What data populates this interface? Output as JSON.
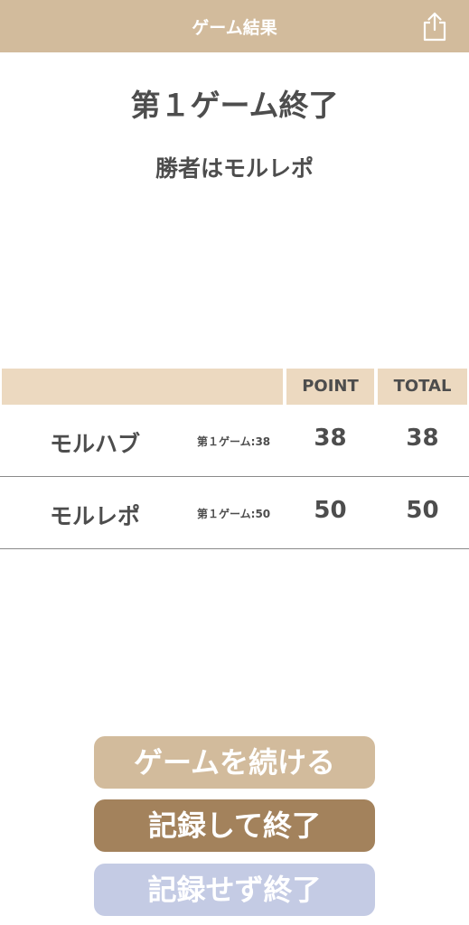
{
  "header": {
    "title": "ゲーム結果",
    "share_icon": "share-icon"
  },
  "main": {
    "game_title": "第１ゲーム終了",
    "winner_text": "勝者はモルレポ"
  },
  "table": {
    "columns": [
      "",
      "POINT",
      "TOTAL"
    ],
    "rows": [
      {
        "name": "モルハブ",
        "history": "第１ゲーム:38",
        "point": "38",
        "total": "38"
      },
      {
        "name": "モルレポ",
        "history": "第１ゲーム:50",
        "point": "50",
        "total": "50"
      }
    ]
  },
  "buttons": {
    "continue_label": "ゲームを続ける",
    "save_label": "記録して終了",
    "nosave_label": "記録せず終了"
  },
  "colors": {
    "header_bg": "#d2bb9c",
    "table_header_bg": "#ecd9c0",
    "continue_bg": "#d2bb9c",
    "save_bg": "#a3825c",
    "nosave_bg": "#c4cbe4"
  }
}
